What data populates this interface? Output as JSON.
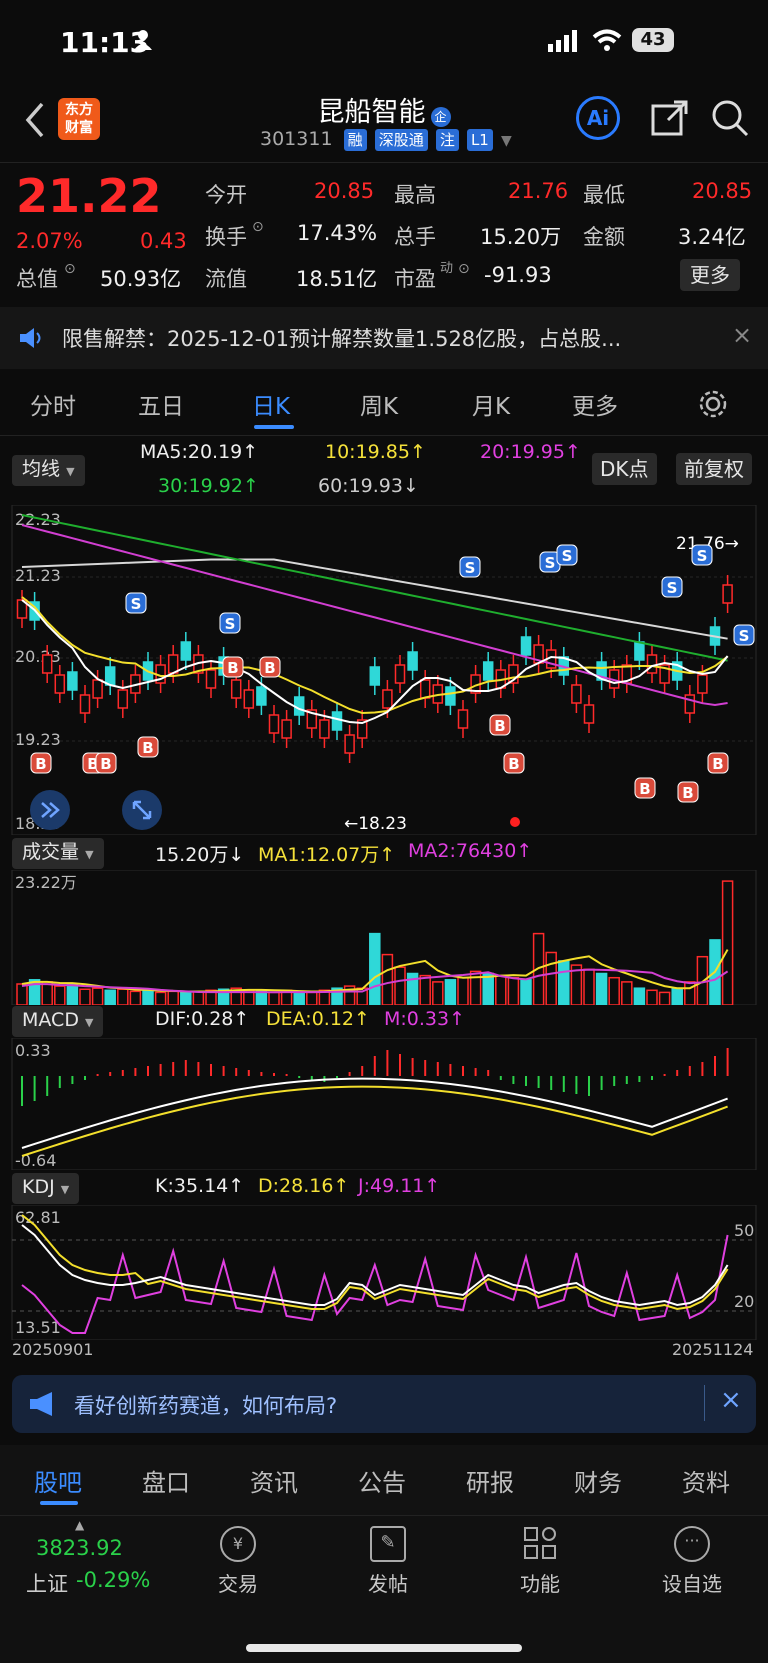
{
  "status_bar": {
    "time": "11:13",
    "battery": "43"
  },
  "header": {
    "logo_text": "东方\n财富",
    "stock_name": "昆船智能",
    "stock_badge": "企",
    "stock_code": "301311",
    "tags": [
      "融",
      "深股通",
      "注",
      "L1"
    ],
    "ai_label": "Ai"
  },
  "quote": {
    "price": "21.22",
    "change_pct": "2.07%",
    "change_abs": "0.43",
    "open_label": "今开",
    "open": "20.85",
    "high_label": "最高",
    "high": "21.76",
    "low_label": "最低",
    "low": "20.85",
    "turnover_label": "换手",
    "turnover": "17.43%",
    "volume_label": "总手",
    "volume": "15.20万",
    "amount_label": "金额",
    "amount": "3.24亿",
    "mktcap_label": "总值",
    "mktcap": "50.93亿",
    "float_label": "流值",
    "float": "18.51亿",
    "pe_label": "市盈",
    "pe_sup": "动",
    "pe": "-91.93",
    "more": "更多"
  },
  "notice": {
    "text": "限售解禁：2025-12-01预计解禁数量1.528亿股，占总股..."
  },
  "chart_tabs": {
    "items": [
      "分时",
      "五日",
      "日K",
      "周K",
      "月K",
      "更多"
    ],
    "active": "日K"
  },
  "ma": {
    "selector": "均线",
    "ma5": "MA5:20.19↑",
    "ma10": "10:19.85↑",
    "ma20": "20:19.95↑",
    "ma30": "30:19.92↑",
    "ma60": "60:19.93↓",
    "dk": "DK点",
    "adjust": "前复权"
  },
  "price_axis": {
    "top": "22.23",
    "mid1": "21.23",
    "mid2": "20.23",
    "mid3": "19.23",
    "bottom": "18.23",
    "high_label": "21.76→",
    "low_label": "←18.23"
  },
  "volume": {
    "selector": "成交量",
    "value": "15.20万↓",
    "ma1": "MA1:12.07万↑",
    "ma2": "MA2:76430↑",
    "axis_top": "23.22万"
  },
  "macd": {
    "selector": "MACD",
    "dif": "DIF:0.28↑",
    "dea": "DEA:0.12↑",
    "m": "M:0.33↑",
    "axis_top": "0.33",
    "axis_bottom": "-0.64"
  },
  "kdj": {
    "selector": "KDJ",
    "k": "K:35.14↑",
    "d": "D:28.16↑",
    "j": "J:49.11↑",
    "axis_top": "62.81",
    "axis_bottom": "13.51",
    "ref_high": "50",
    "ref_low": "20",
    "date_start": "20250901",
    "date_end": "20251124"
  },
  "ad_banner": {
    "text": "看好创新药赛道，如何布局?"
  },
  "bottom_tabs": {
    "items": [
      "股吧",
      "盘口",
      "资讯",
      "公告",
      "研报",
      "财务",
      "资料"
    ],
    "active": "股吧"
  },
  "bottom_nav": {
    "index_value": "3823.92",
    "index_name": "上证",
    "index_change": "-0.29%",
    "items": [
      "交易",
      "发帖",
      "功能",
      "设自选"
    ]
  },
  "colors": {
    "up": "#ff2a2a",
    "down": "#2fd8d8",
    "accent": "#2a7bff",
    "brand": "#f05a1a"
  }
}
